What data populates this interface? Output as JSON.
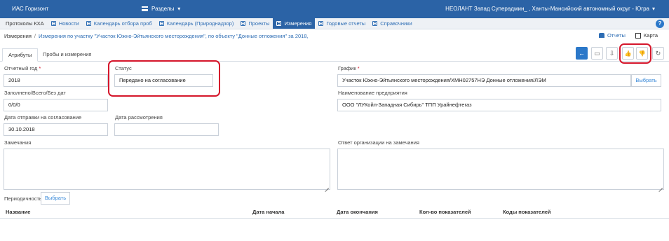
{
  "header": {
    "app_title": "ИАС Горизонт",
    "sections_label": "Разделы",
    "user_label": "НЕОЛАНТ Запад Суперадмин_ , Ханты-Мансийский автономный округ - Югра"
  },
  "nav": {
    "items": [
      {
        "label": "Протоколы КХА"
      },
      {
        "label": "Новости"
      },
      {
        "label": "Календарь отбора проб"
      },
      {
        "label": "Календарь (Природнадзор)"
      },
      {
        "label": "Проекты"
      },
      {
        "label": "Измерения"
      },
      {
        "label": "Годовые отчеты"
      },
      {
        "label": "Справочники"
      }
    ],
    "help": "?"
  },
  "breadcrumb": {
    "root": "Измерения",
    "separator": "/",
    "current": "Измерения по участку \"Участок Южно-Эйтьянского месторождения\", по объекту \"Донные отложения\" за 2018,"
  },
  "top_actions": {
    "reports": "Отчеты",
    "map": "Карта"
  },
  "tabs": [
    {
      "label": "Атрибуты"
    },
    {
      "label": "Пробы и измерения"
    }
  ],
  "toolbar": {
    "back": "←",
    "save": "▭",
    "export": "⇩",
    "like": "👍",
    "dislike": "👎",
    "refresh": "↻"
  },
  "form": {
    "report_year": {
      "label": "Отчетный год",
      "required_mark": "*",
      "value": "2018"
    },
    "status": {
      "label": "Статус",
      "value": "Передано на согласование"
    },
    "schedule": {
      "label": "График",
      "required_mark": "*",
      "value": "Участок Южно-Эйтьянского месторождения/ХМН02757НЭ Донные отложения/ЛЭМ",
      "select_label": "Выбрать"
    },
    "filled": {
      "label": "Заполнено/Всего/Без дат",
      "value": "0/0/0"
    },
    "company": {
      "label": "Наименование предприятия",
      "value": "ООО \"ЛУКойл-Западная Сибирь\" ТПП Урайнефтегаз"
    },
    "sent_date": {
      "label": "Дата отправки на согласование",
      "value": "30.10.2018"
    },
    "review_date": {
      "label": "Дата рассмотрения",
      "value": ""
    },
    "remarks": {
      "label": "Замечания",
      "value": ""
    },
    "org_response": {
      "label": "Ответ организации на замечания",
      "value": ""
    },
    "periodicity": {
      "label": "Периодичность",
      "select_label": "Выбрать"
    }
  },
  "table": {
    "columns": [
      "Название",
      "Дата начала",
      "Дата окончания",
      "Кол-во показателей",
      "Коды показателей"
    ],
    "rows": []
  },
  "colors": {
    "header_bg": "#2b63a6",
    "accent": "#2b78c9",
    "link": "#2d6db4",
    "highlight": "#d5162b"
  }
}
